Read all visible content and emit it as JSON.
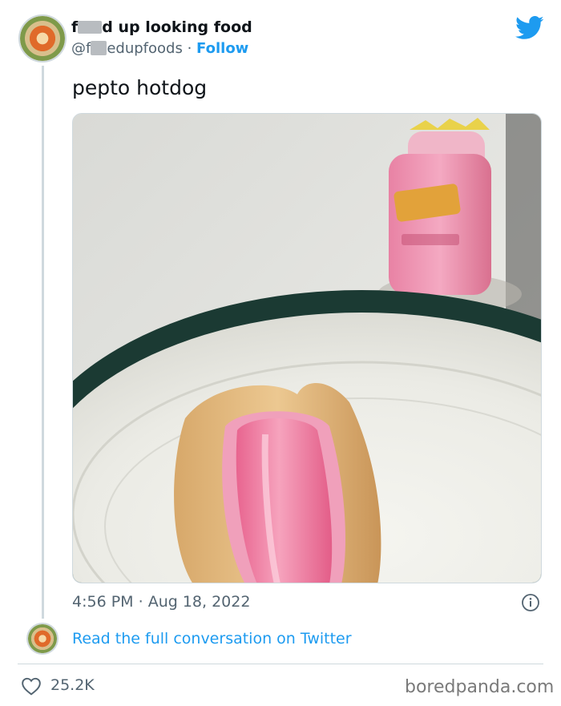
{
  "tweet": {
    "author_name_prefix": "f",
    "author_name_suffix": "d up looking food",
    "handle_prefix": "@f",
    "handle_suffix": "edupfoods",
    "separator": "·",
    "follow_label": "Follow",
    "text": "pepto hotdog",
    "time": "4:56 PM",
    "date": "Aug 18, 2022",
    "likes": "25.2K"
  },
  "conversation": {
    "link_label": "Read the full conversation on Twitter"
  },
  "watermark": "boredpanda.com",
  "icons": [
    "avatar",
    "twitter-bird-icon",
    "info-icon",
    "heart-icon"
  ],
  "colors": {
    "link_blue": "#1d9bf0",
    "text_primary": "#0f1419",
    "text_secondary": "#536471",
    "border": "#cfd9de"
  }
}
